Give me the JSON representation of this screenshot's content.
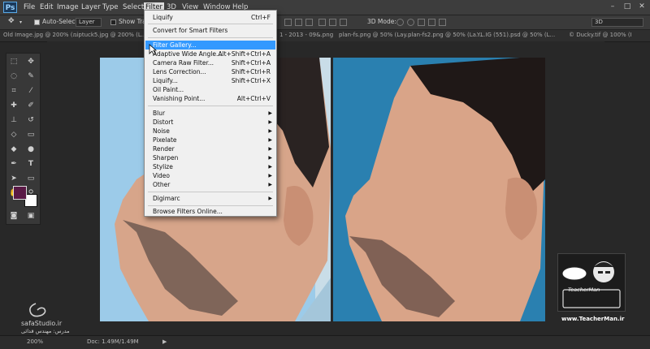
{
  "menubar": {
    "logo": "Ps",
    "items": [
      "File",
      "Edit",
      "Image",
      "Layer",
      "Type",
      "Select",
      "Filter",
      "3D",
      "View",
      "Window",
      "Help"
    ],
    "window_buttons": [
      "–",
      "□",
      "✕"
    ]
  },
  "options": {
    "auto_select_label": "Auto-Select:",
    "auto_select_value": "Layer",
    "show_transform_label": "Show Tran",
    "mode_label": "3D Mode:",
    "workspace_value": "3D"
  },
  "tabs": [
    "Old Image.jpg @ 200% (...",
    "niptuck5.jpg @ 200% (L...",
    "1 - 2013 - 09&.png",
    "plan-fs.png @ 50% (Lay...",
    "plan-fs2.png @ 50% (La...",
    "YL.IG (551).psd @ 50% (L...",
    "© Ducky.tif @ 100% (I"
  ],
  "filter_menu": {
    "items": [
      {
        "label": "Liquify",
        "shortcut": "Ctrl+F",
        "arrow": false,
        "highlight": false
      },
      {
        "label": "Convert for Smart Filters",
        "shortcut": "",
        "arrow": false,
        "highlight": false
      },
      {
        "label": "Filter Gallery...",
        "shortcut": "",
        "arrow": false,
        "highlight": true
      },
      {
        "label": "Adaptive Wide Angle...",
        "shortcut": "Alt+Shift+Ctrl+A",
        "arrow": false,
        "highlight": false
      },
      {
        "label": "Camera Raw Filter...",
        "shortcut": "Shift+Ctrl+A",
        "arrow": false,
        "highlight": false
      },
      {
        "label": "Lens Correction...",
        "shortcut": "Shift+Ctrl+R",
        "arrow": false,
        "highlight": false
      },
      {
        "label": "Liquify...",
        "shortcut": "Shift+Ctrl+X",
        "arrow": false,
        "highlight": false
      },
      {
        "label": "Oil Paint...",
        "shortcut": "",
        "arrow": false,
        "highlight": false
      },
      {
        "label": "Vanishing Point...",
        "shortcut": "Alt+Ctrl+V",
        "arrow": false,
        "highlight": false
      },
      {
        "label": "Blur",
        "shortcut": "",
        "arrow": true,
        "highlight": false
      },
      {
        "label": "Distort",
        "shortcut": "",
        "arrow": true,
        "highlight": false
      },
      {
        "label": "Noise",
        "shortcut": "",
        "arrow": true,
        "highlight": false
      },
      {
        "label": "Pixelate",
        "shortcut": "",
        "arrow": true,
        "highlight": false
      },
      {
        "label": "Render",
        "shortcut": "",
        "arrow": true,
        "highlight": false
      },
      {
        "label": "Sharpen",
        "shortcut": "",
        "arrow": true,
        "highlight": false
      },
      {
        "label": "Stylize",
        "shortcut": "",
        "arrow": true,
        "highlight": false
      },
      {
        "label": "Video",
        "shortcut": "",
        "arrow": true,
        "highlight": false
      },
      {
        "label": "Other",
        "shortcut": "",
        "arrow": true,
        "highlight": false
      },
      {
        "label": "Digimarc",
        "shortcut": "",
        "arrow": true,
        "highlight": false
      },
      {
        "label": "Browse Filters Online...",
        "shortcut": "",
        "arrow": false,
        "highlight": false
      }
    ],
    "arrow_glyph": "▶"
  },
  "status": {
    "zoom": "200%",
    "doc_info": "Doc: 1.49M/1.49M"
  },
  "watermark_left": {
    "site": "safaStudio.ir",
    "credit": "مدرس: مهندس قدائی"
  },
  "watermark_right": {
    "site": "www.TeacherMan.ir",
    "brand": "TeacherMan"
  },
  "colors": {
    "foreground": "#5a1a46",
    "background": "#ffffff",
    "highlight": "#3399ff"
  }
}
